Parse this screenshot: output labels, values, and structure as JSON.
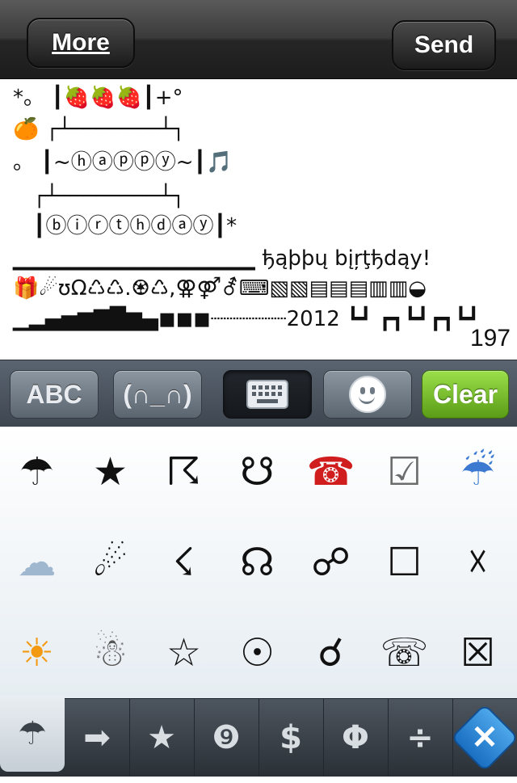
{
  "nav": {
    "more_label": "More",
    "send_label": "Send"
  },
  "message": {
    "lines": [
      "*。 ┃🍓🍓🍓┃+°",
      "🍊 ┌┴───────┴┐",
      "。 ┃~ⓗⓐⓟⓟⓨ~┃🎵",
      "   ┌┴────────┴┐",
      "   ┃ⓑⓘⓡⓣⓗⓓⓐⓨ┃*",
      "▁▁▁▁▁▁▁▁▁▁▁▁▁▁▁ ђąþþų bįŗţђdąy!",
      "🎁☄ʊΩ♺♺.♼♺,⚢⚤⚦⌨▧▧▤▤▤▥▥◒",
      "▁▂▄▅▆▇█▆▄◼◼◼┈┈┈┈┈┈2012 ┗┛ ┏┓┗┛┏┓┗┛"
    ],
    "char_count": "197"
  },
  "modebar": {
    "abc_label": "ABC",
    "kaomoji_label": "(∩_∩)",
    "keyboard_icon": "keyboard-icon",
    "emoji_icon": "smiley-icon",
    "clear_label": "Clear"
  },
  "symbols": [
    [
      "☂",
      "★",
      "☈",
      "☋",
      "☎",
      "☑",
      "☔"
    ],
    [
      "☁",
      "☄",
      "☇",
      "☊",
      "☍",
      "☐",
      "☓"
    ],
    [
      "☀",
      "☃",
      "☆",
      "☉",
      "☌",
      "☏",
      "☒"
    ]
  ],
  "symbol_colors": {
    "telephone": "#d01d1d",
    "check_box": "#6b6b6b",
    "umbrella_rain": "#3c7ad1",
    "sun": "#f39a12",
    "cloud": "#9fb7cf"
  },
  "tabs": {
    "umbrella": "☂",
    "arrow": "➡",
    "star": "★",
    "number": "❾",
    "currency": "$",
    "greek": "Φ",
    "math": "÷",
    "delete": "✕"
  }
}
